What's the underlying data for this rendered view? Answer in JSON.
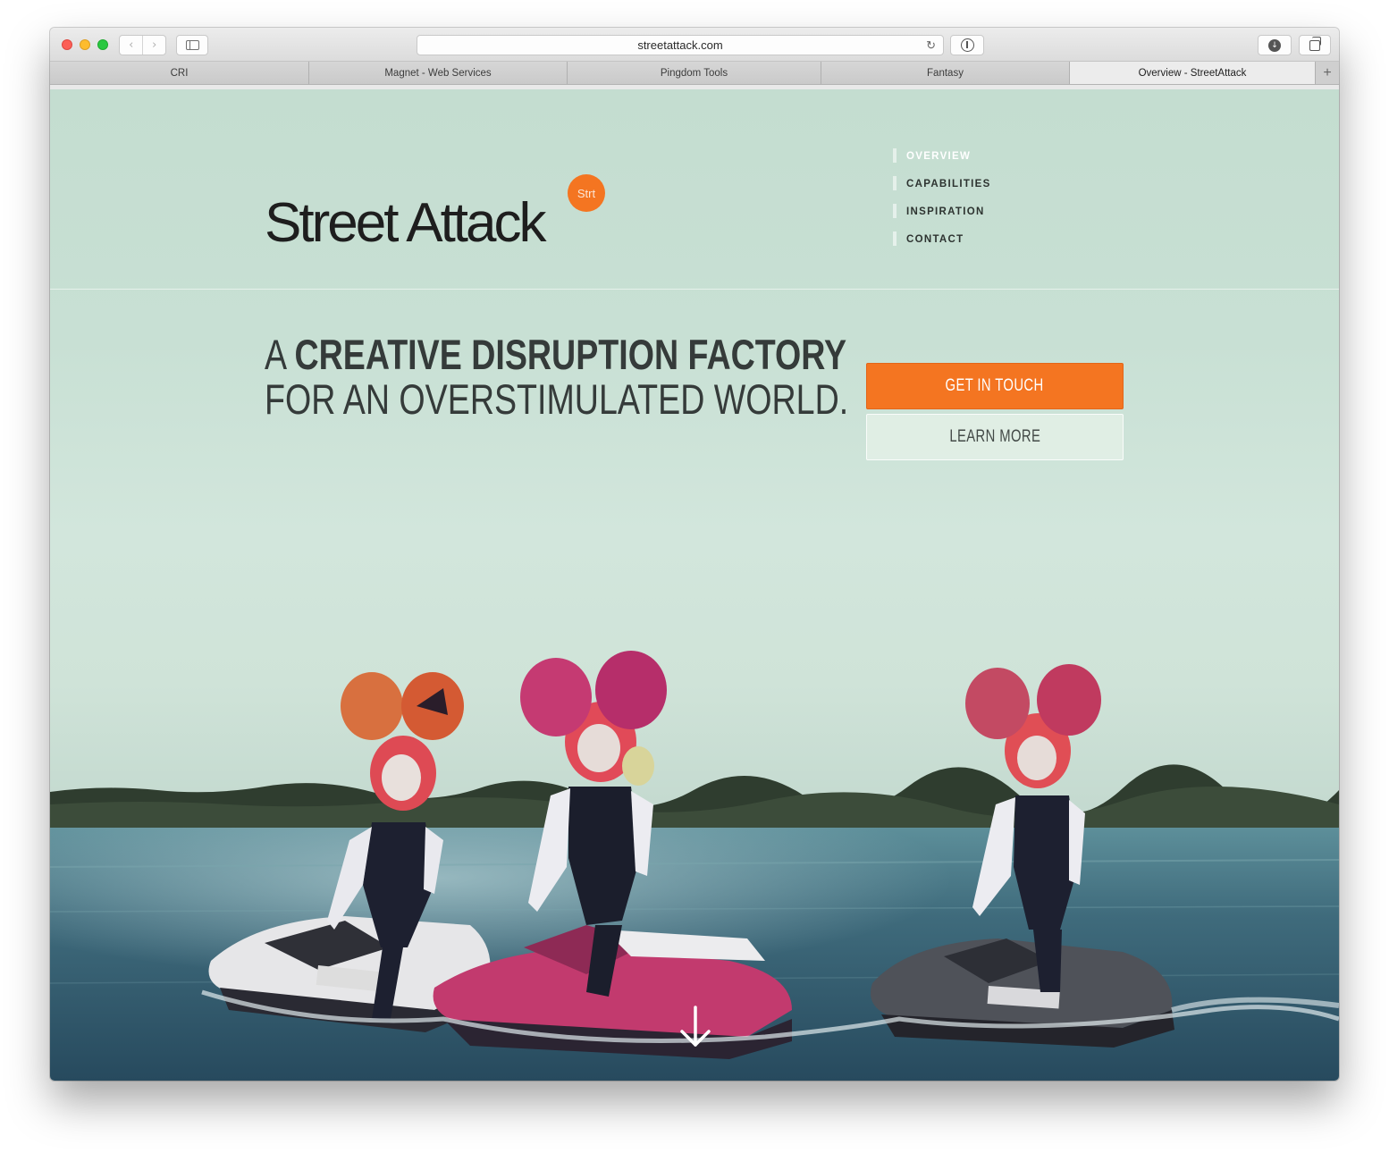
{
  "browser": {
    "url": "streetattack.com",
    "tabs": [
      {
        "label": "CRI",
        "active": false
      },
      {
        "label": "Magnet - Web Services",
        "active": false
      },
      {
        "label": "Pingdom Tools",
        "active": false
      },
      {
        "label": "Fantasy",
        "active": false
      },
      {
        "label": "Overview - StreetAttack",
        "active": true
      }
    ],
    "icons": [
      "back-icon",
      "forward-icon",
      "sidebar-icon",
      "reload-icon",
      "reader-icon",
      "download-icon",
      "tabs-overview-icon",
      "new-tab-icon"
    ]
  },
  "site": {
    "logo_text": "Street Attack",
    "logo_badge": "Strt",
    "nav": [
      {
        "label": "OVERVIEW",
        "active": true
      },
      {
        "label": "CAPABILITIES",
        "active": false
      },
      {
        "label": "INSPIRATION",
        "active": false
      },
      {
        "label": "CONTACT",
        "active": false
      }
    ],
    "headline_prefix": "A ",
    "headline_bold": "CREATIVE DISRUPTION FACTORY",
    "headline_line2": "FOR AN OVERSTIMULATED WORLD.",
    "cta_primary": "GET IN TOUCH",
    "cta_secondary": "LEARN MORE",
    "accent_color": "#f47521",
    "scroll_icon": "arrow-down-icon"
  }
}
